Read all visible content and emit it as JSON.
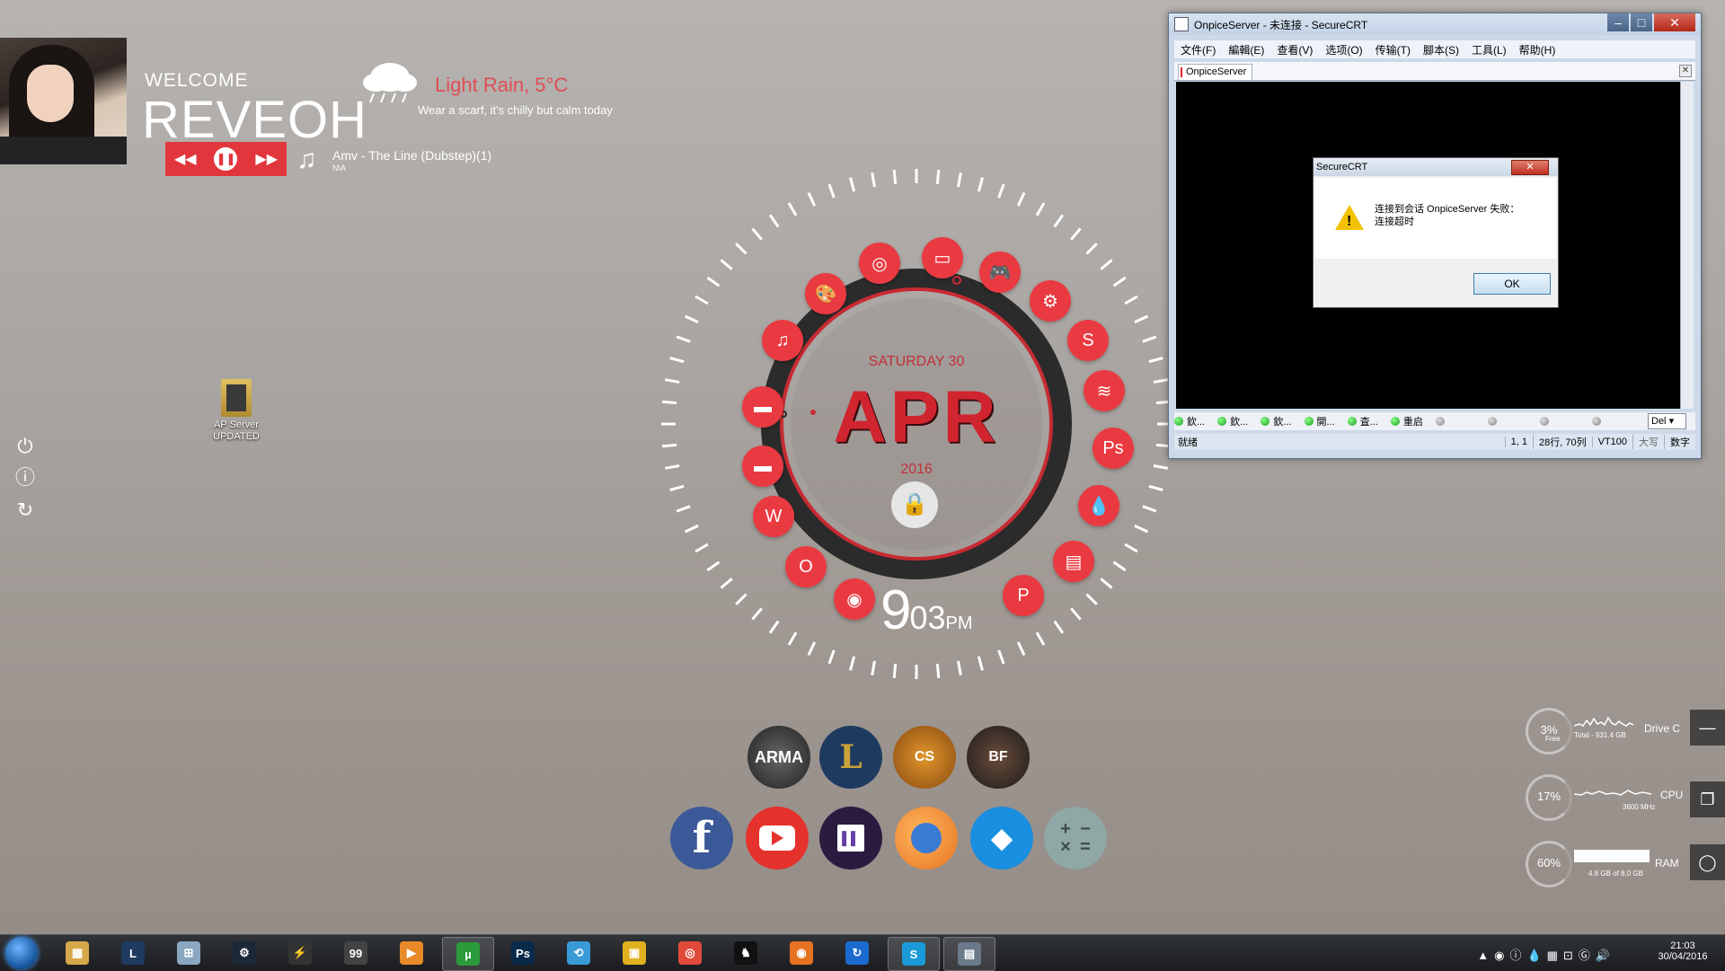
{
  "profile": {
    "welcome": "WELCOME",
    "username": "REVEOH"
  },
  "weather": {
    "condition": "Light Rain, 5°C",
    "description": "Wear a scarf, it's chilly but calm today"
  },
  "player": {
    "track": "Amv - The Line (Dubstep)(1)",
    "artist": "N\\A"
  },
  "desktop_icons": [
    {
      "label": "AP Server UPDATED"
    }
  ],
  "clock": {
    "day": "SATURDAY 30",
    "month": "APR",
    "year": "2016",
    "hour": "9",
    "minute": "03",
    "ampm": "PM"
  },
  "ring_apps": [
    "folder-music-icon",
    "palette-icon",
    "chrome-icon",
    "folder-icon",
    "gamepad-icon",
    "steam-icon",
    "skype-icon",
    "spotify-icon",
    "photoshop-icon",
    "droplet-icon",
    "monitor-icon",
    "powerpoint-icon",
    "origin-icon",
    "outlook-icon",
    "word-icon",
    "folder-icon-2",
    "folder-icon-3"
  ],
  "ring_labels": {
    "photoshop": "Ps"
  },
  "games": [
    "ARMA",
    "L",
    "CS",
    "BF"
  ],
  "social": [
    "facebook",
    "youtube",
    "twitch",
    "firefox",
    "dropbox",
    "calculator"
  ],
  "securecrt": {
    "title": "OnpiceServer - 未连接 - SecureCRT",
    "menu": [
      "文件(F)",
      "編輯(E)",
      "查看(V)",
      "选项(O)",
      "传输(T)",
      "腳本(S)",
      "工具(L)",
      "帮助(H)"
    ],
    "tab": "OnpiceServer",
    "buttons": [
      "欽...",
      "欽...",
      "欽...",
      "開...",
      "査...",
      "重启"
    ],
    "del": "Del",
    "status": {
      "ready": "就绪",
      "pos": "1,  1",
      "size": "28行, 70列",
      "term": "VT100",
      "caps": "大写",
      "num": "数字"
    },
    "dialog": {
      "title": "SecureCRT",
      "line1": "连接到会话 OnpiceServer 失败：",
      "line2": "连接超时",
      "ok": "OK"
    }
  },
  "meters": {
    "drive": {
      "value": "3%",
      "sub": "Free",
      "label": "Drive C",
      "detail": "Total - 931.4 GB"
    },
    "cpu": {
      "value": "17%",
      "label": "CPU",
      "detail": "3600 MHz"
    },
    "ram": {
      "value": "60%",
      "label": "RAM",
      "detail": "4.8 GB of 8.0 GB"
    }
  },
  "taskbar": {
    "time": "21:03",
    "date": "30/04/2016"
  },
  "colors": {
    "accent": "#ea3a41",
    "ring_dark": "#2b2b2b"
  }
}
